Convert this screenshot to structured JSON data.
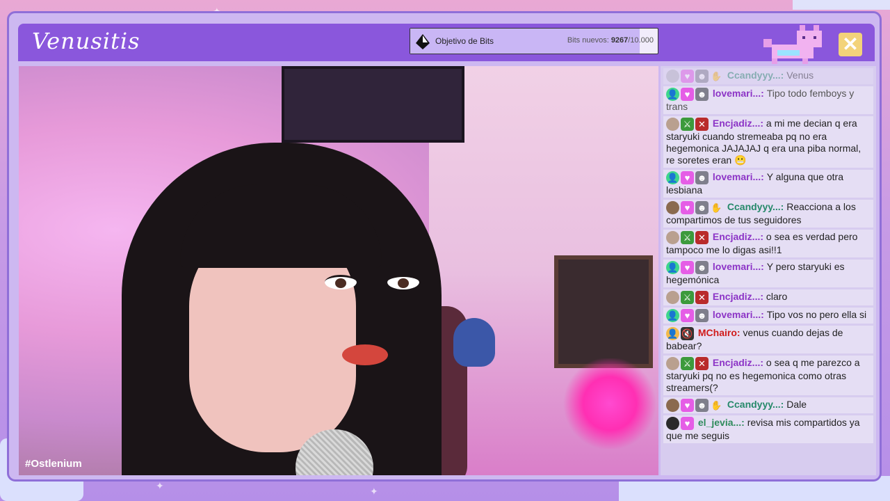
{
  "overlay": {
    "channel_title": "Venusitis",
    "hashtag": "#Ostlenium",
    "close_symbol": "✕"
  },
  "bits_goal": {
    "label": "Objetivo de Bits",
    "progress_prefix": "Bits nuevos:",
    "current": "9267",
    "target": "/10.000",
    "progress_fraction": 0.9267
  },
  "chat": {
    "messages": [
      {
        "faded": true,
        "badges": [
          "avatar-gray",
          "heart",
          "raccoon",
          "sign"
        ],
        "user": "Ccandyyy...:",
        "color": "teal",
        "text": "Venus"
      },
      {
        "faded": false,
        "badges": [
          "avatar-green",
          "heart",
          "raccoon"
        ],
        "user": "lovemari...:",
        "color": "purple",
        "text": "Tipo todo femboys y trans",
        "dim": true
      },
      {
        "faded": false,
        "badges": [
          "avatar-photo",
          "sword",
          "cross"
        ],
        "user": "Encjadiz...:",
        "color": "purple",
        "text": "a mi me decian q era staryuki cuando stremeaba pq no era hegemonica JAJAJAJ q era una piba normal, re soretes eran 😬"
      },
      {
        "faded": false,
        "badges": [
          "avatar-green",
          "heart",
          "raccoon"
        ],
        "user": "lovemari...:",
        "color": "purple",
        "text": "Y alguna que otra lesbiana"
      },
      {
        "faded": false,
        "badges": [
          "avatar-photo2",
          "heart",
          "raccoon",
          "sign"
        ],
        "user": "Ccandyyy...:",
        "color": "teal",
        "text": "Reacciona a los compartimos de tus seguidores"
      },
      {
        "faded": false,
        "badges": [
          "avatar-photo",
          "sword",
          "cross"
        ],
        "user": "Encjadiz...:",
        "color": "purple",
        "text": "o sea es verdad pero tampoco me lo digas asi!!1"
      },
      {
        "faded": false,
        "badges": [
          "avatar-green",
          "heart",
          "raccoon"
        ],
        "user": "lovemari...:",
        "color": "purple",
        "text": "Y pero staryuki es hegemónica"
      },
      {
        "faded": false,
        "badges": [
          "avatar-photo",
          "sword",
          "cross"
        ],
        "user": "Encjadiz...:",
        "color": "purple",
        "text": "claro"
      },
      {
        "faded": false,
        "badges": [
          "avatar-green",
          "heart",
          "raccoon"
        ],
        "user": "lovemari...:",
        "color": "purple",
        "text": "Tipo vos no pero ella si"
      },
      {
        "faded": false,
        "badges": [
          "avatar-yellow",
          "mute"
        ],
        "user": "MChairo:",
        "color": "red",
        "text": "venus cuando dejas de babear?"
      },
      {
        "faded": false,
        "badges": [
          "avatar-photo",
          "sword",
          "cross"
        ],
        "user": "Encjadiz...:",
        "color": "purple",
        "text": "o sea q me parezco a staryuki pq no es hegemonica como otras streamers(?"
      },
      {
        "faded": false,
        "badges": [
          "avatar-photo2",
          "heart",
          "raccoon",
          "sign"
        ],
        "user": "Ccandyyy...:",
        "color": "teal",
        "text": "Dale"
      },
      {
        "faded": false,
        "badges": [
          "avatar-dark",
          "heart"
        ],
        "user": "el_jevia...:",
        "color": "green",
        "text": "revisa mis compartidos ya que me seguis"
      }
    ]
  },
  "colors": {
    "topbar": "#8a57dc",
    "frame": "#cdb8f1",
    "accent_yellow": "#f3d37a"
  }
}
